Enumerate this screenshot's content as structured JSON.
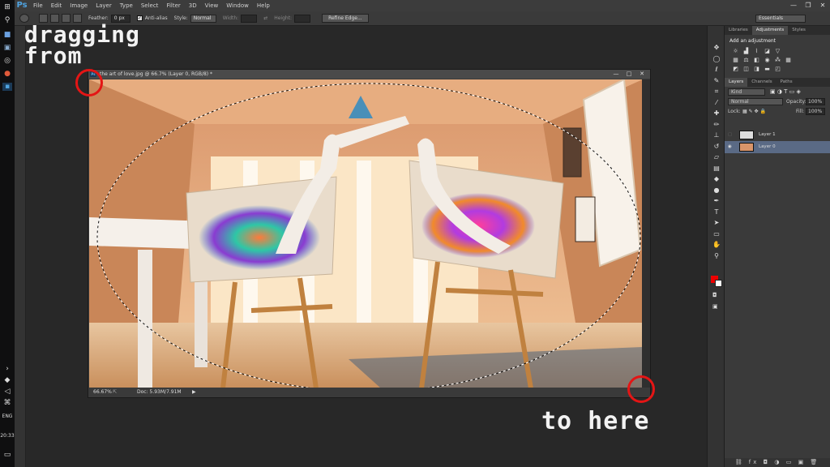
{
  "app": {
    "logo": "Ps"
  },
  "menu": [
    "File",
    "Edit",
    "Image",
    "Layer",
    "Type",
    "Select",
    "Filter",
    "3D",
    "View",
    "Window",
    "Help"
  ],
  "window_controls": {
    "minimize": "—",
    "restore": "❐",
    "close": "✕"
  },
  "options": {
    "feather_label": "Feather:",
    "feather_value": "0 px",
    "antialias_label": "Anti-alias",
    "style_label": "Style:",
    "style_value": "Normal",
    "width_label": "Width:",
    "height_label": "Height:",
    "refine_label": "Refine Edge...",
    "workspace_value": "Essentials"
  },
  "document": {
    "title": "the art of love.jpg @ 66.7% (Layer 0, RGB/8) *",
    "zoom": "66.67%",
    "doc_size": "Doc: 5.93M/7.91M"
  },
  "annotations": {
    "top": [
      "dragging",
      "from"
    ],
    "bottom": "to here"
  },
  "panels": {
    "top_tabs": [
      "Libraries",
      "Adjustments",
      "Styles"
    ],
    "adj_title": "Add an adjustment",
    "layers_tabs": [
      "Layers",
      "Channels",
      "Paths"
    ],
    "kind_label": "Kind",
    "blend_mode": "Normal",
    "opacity_label": "Opacity:",
    "opacity_value": "100%",
    "lock_label": "Lock:",
    "fill_label": "Fill:",
    "fill_value": "100%",
    "layers": [
      "Layer 1",
      "Layer 0"
    ]
  },
  "taskbar": {
    "lang": "ENG",
    "time": "20:33"
  }
}
